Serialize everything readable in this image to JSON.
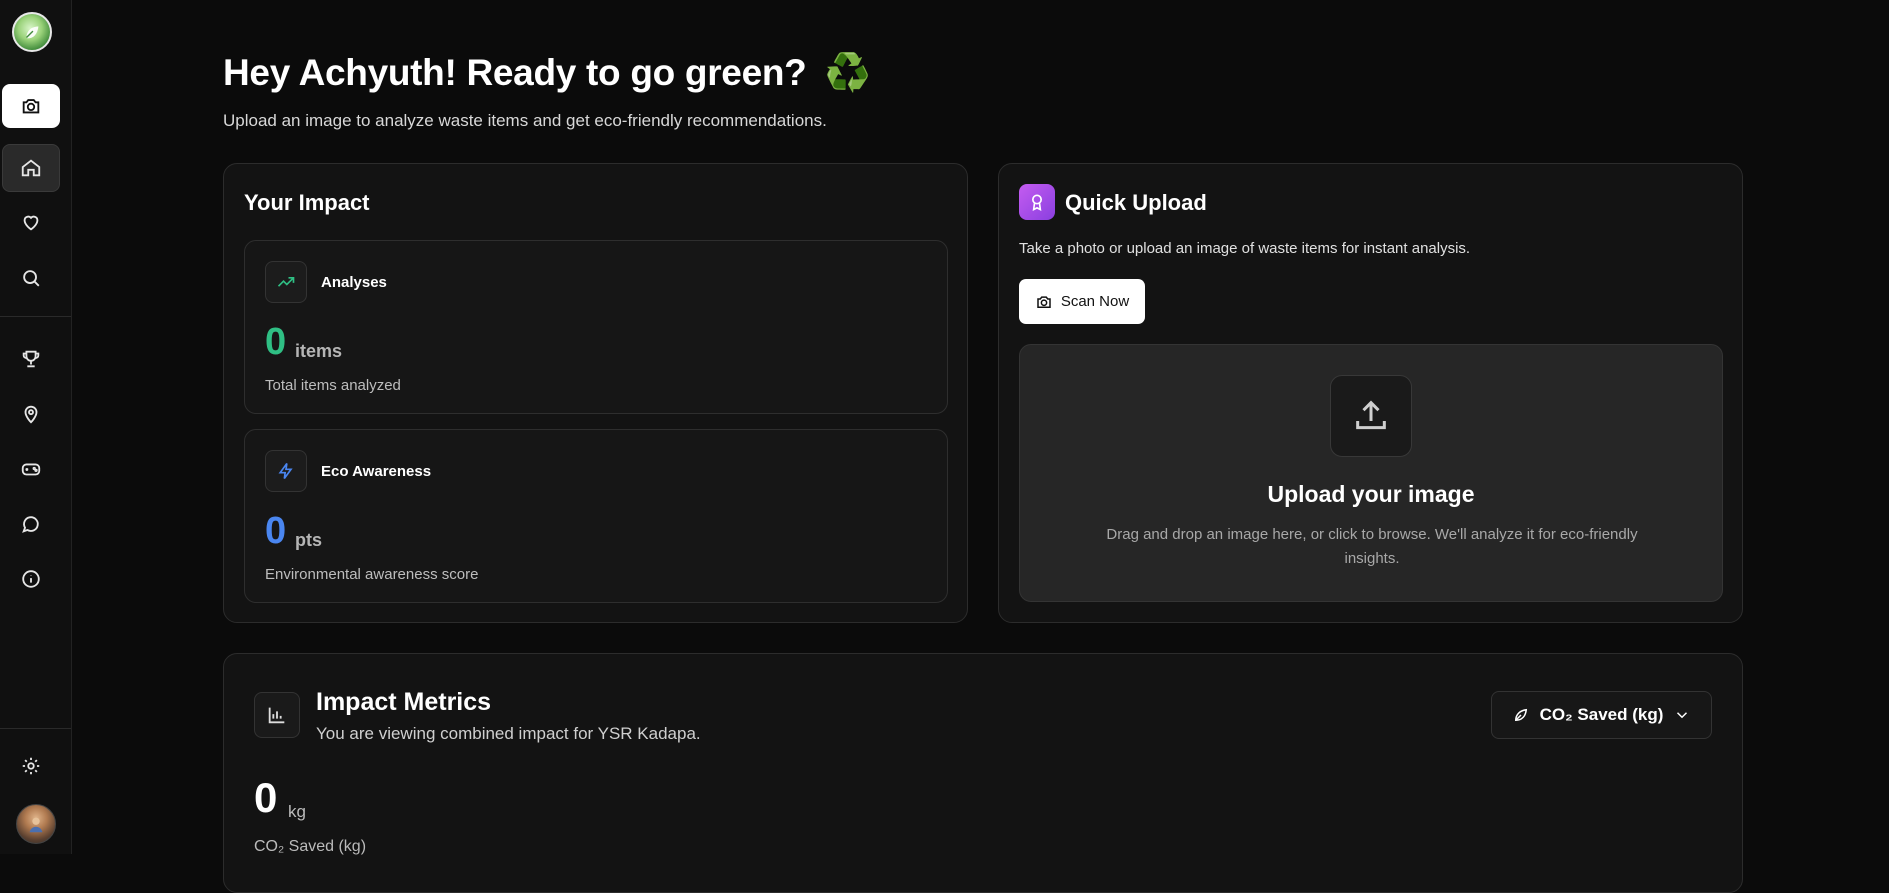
{
  "header": {
    "greeting": "Hey Achyuth! Ready to go green?",
    "greeting_emoji": "♻️",
    "subtitle": "Upload an image to analyze waste items and get eco-friendly recommendations."
  },
  "sidebar": {
    "items": [
      {
        "icon": "camera-icon"
      },
      {
        "icon": "home-icon",
        "active": true
      },
      {
        "icon": "heart-icon"
      },
      {
        "icon": "search-icon"
      },
      {
        "icon": "trophy-icon"
      },
      {
        "icon": "map-pin-icon"
      },
      {
        "icon": "gamepad-icon"
      },
      {
        "icon": "chat-icon"
      },
      {
        "icon": "info-icon"
      }
    ],
    "bottom": [
      {
        "icon": "settings-icon"
      },
      {
        "icon": "avatar"
      }
    ]
  },
  "impact": {
    "title": "Your Impact",
    "analyses": {
      "label": "Analyses",
      "value": "0",
      "unit": "items",
      "description": "Total items analyzed",
      "color": "#2fbf84"
    },
    "eco": {
      "label": "Eco Awareness",
      "value": "0",
      "unit": "pts",
      "description": "Environmental awareness score",
      "color": "#4a86f0"
    }
  },
  "quick_upload": {
    "title": "Quick Upload",
    "description": "Take a photo or upload an image of waste items for instant analysis.",
    "scan_button": "Scan Now",
    "drop_title": "Upload your image",
    "drop_description": "Drag and drop an image here, or click to browse. We'll analyze it for eco-friendly insights."
  },
  "metrics": {
    "title": "Impact Metrics",
    "subtitle": "You are viewing combined impact for YSR Kadapa.",
    "selector": "CO₂ Saved (kg)",
    "value": "0",
    "unit": "kg",
    "label": "CO₂ Saved (kg)"
  }
}
